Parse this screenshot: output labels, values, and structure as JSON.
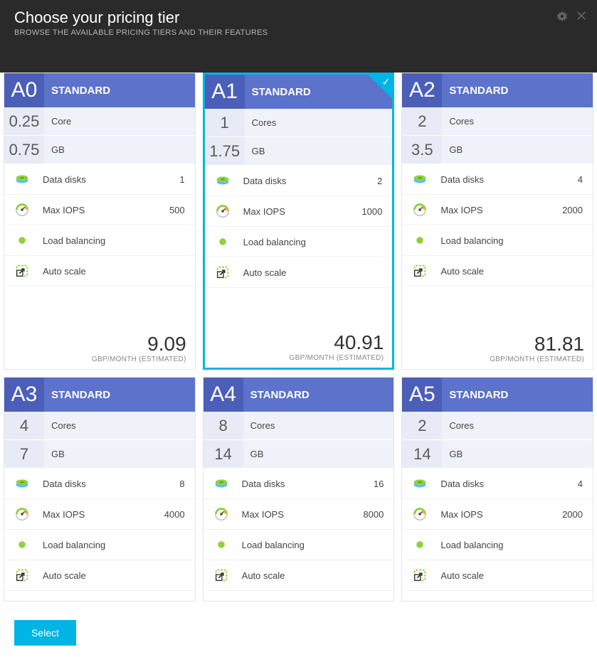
{
  "header": {
    "title": "Choose your pricing tier",
    "subtitle": "BROWSE THE AVAILABLE PRICING TIERS AND THEIR FEATURES"
  },
  "price_suffix": "GBP/MONTH (ESTIMATED)",
  "select_button": "Select",
  "selected_index": 1,
  "tiers": [
    {
      "code": "A0",
      "label": "STANDARD",
      "cores_value": "0.25",
      "cores_label": "Core",
      "gb_value": "0.75",
      "gb_label": "GB",
      "disks_label": "Data disks",
      "disks_value": "1",
      "iops_label": "Max IOPS",
      "iops_value": "500",
      "lb_label": "Load balancing",
      "as_label": "Auto scale",
      "price": "9.09"
    },
    {
      "code": "A1",
      "label": "STANDARD",
      "cores_value": "1",
      "cores_label": "Cores",
      "gb_value": "1.75",
      "gb_label": "GB",
      "disks_label": "Data disks",
      "disks_value": "2",
      "iops_label": "Max IOPS",
      "iops_value": "1000",
      "lb_label": "Load balancing",
      "as_label": "Auto scale",
      "price": "40.91"
    },
    {
      "code": "A2",
      "label": "STANDARD",
      "cores_value": "2",
      "cores_label": "Cores",
      "gb_value": "3.5",
      "gb_label": "GB",
      "disks_label": "Data disks",
      "disks_value": "4",
      "iops_label": "Max IOPS",
      "iops_value": "2000",
      "lb_label": "Load balancing",
      "as_label": "Auto scale",
      "price": "81.81"
    },
    {
      "code": "A3",
      "label": "STANDARD",
      "cores_value": "4",
      "cores_label": "Cores",
      "gb_value": "7",
      "gb_label": "GB",
      "disks_label": "Data disks",
      "disks_value": "8",
      "iops_label": "Max IOPS",
      "iops_value": "4000",
      "lb_label": "Load balancing",
      "as_label": "Auto scale",
      "price": ""
    },
    {
      "code": "A4",
      "label": "STANDARD",
      "cores_value": "8",
      "cores_label": "Cores",
      "gb_value": "14",
      "gb_label": "GB",
      "disks_label": "Data disks",
      "disks_value": "16",
      "iops_label": "Max IOPS",
      "iops_value": "8000",
      "lb_label": "Load balancing",
      "as_label": "Auto scale",
      "price": ""
    },
    {
      "code": "A5",
      "label": "STANDARD",
      "cores_value": "2",
      "cores_label": "Cores",
      "gb_value": "14",
      "gb_label": "GB",
      "disks_label": "Data disks",
      "disks_value": "4",
      "iops_label": "Max IOPS",
      "iops_value": "2000",
      "lb_label": "Load balancing",
      "as_label": "Auto scale",
      "price": ""
    }
  ]
}
